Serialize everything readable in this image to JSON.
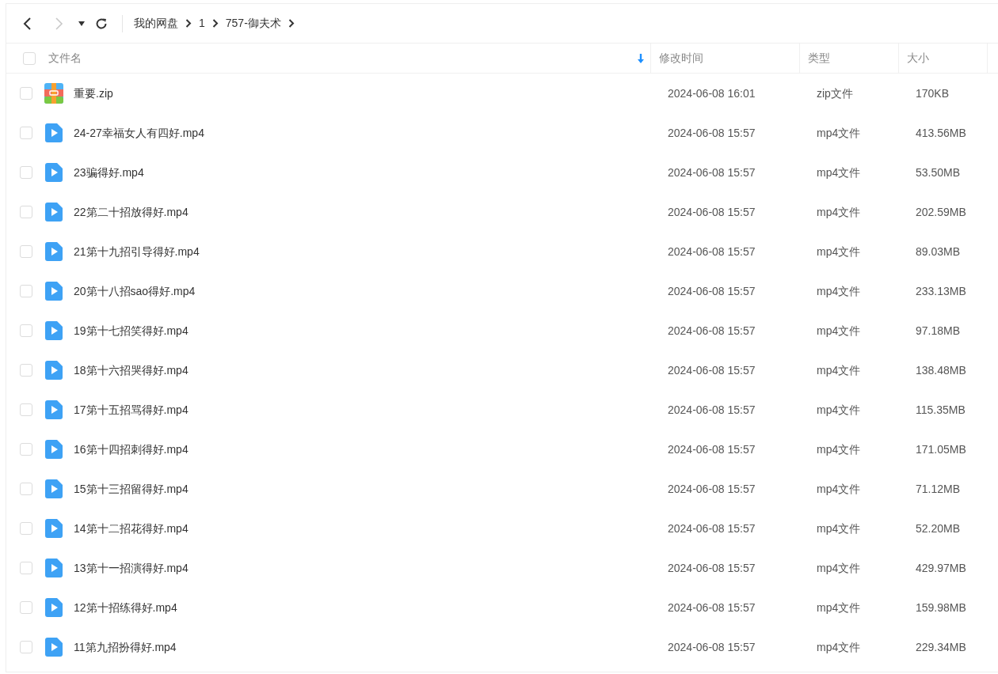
{
  "breadcrumb": [
    "我的网盘",
    "1",
    "757-御夫术"
  ],
  "select_all": {
    "checked": false
  },
  "columns": [
    {
      "label": "文件名"
    },
    {
      "label": "修改时间"
    },
    {
      "label": "类型"
    },
    {
      "label": "大小"
    }
  ],
  "rows": [
    {
      "kind": "zip",
      "name": "重要.zip",
      "modified": "2024-06-08 16:01",
      "type": "zip文件",
      "size": "170KB",
      "checked": false
    },
    {
      "kind": "video",
      "name": "24-27幸福女人有四好.mp4",
      "modified": "2024-06-08 15:57",
      "type": "mp4文件",
      "size": "413.56MB",
      "checked": false
    },
    {
      "kind": "video",
      "name": "23骗得好.mp4",
      "modified": "2024-06-08 15:57",
      "type": "mp4文件",
      "size": "53.50MB",
      "checked": false
    },
    {
      "kind": "video",
      "name": "22第二十招放得好.mp4",
      "modified": "2024-06-08 15:57",
      "type": "mp4文件",
      "size": "202.59MB",
      "checked": false
    },
    {
      "kind": "video",
      "name": "21第十九招引导得好.mp4",
      "modified": "2024-06-08 15:57",
      "type": "mp4文件",
      "size": "89.03MB",
      "checked": false
    },
    {
      "kind": "video",
      "name": "20第十八招sao得好.mp4",
      "modified": "2024-06-08 15:57",
      "type": "mp4文件",
      "size": "233.13MB",
      "checked": false
    },
    {
      "kind": "video",
      "name": "19第十七招笑得好.mp4",
      "modified": "2024-06-08 15:57",
      "type": "mp4文件",
      "size": "97.18MB",
      "checked": false
    },
    {
      "kind": "video",
      "name": "18第十六招哭得好.mp4",
      "modified": "2024-06-08 15:57",
      "type": "mp4文件",
      "size": "138.48MB",
      "checked": false
    },
    {
      "kind": "video",
      "name": "17第十五招骂得好.mp4",
      "modified": "2024-06-08 15:57",
      "type": "mp4文件",
      "size": "115.35MB",
      "checked": false
    },
    {
      "kind": "video",
      "name": "16第十四招刺得好.mp4",
      "modified": "2024-06-08 15:57",
      "type": "mp4文件",
      "size": "171.05MB",
      "checked": false
    },
    {
      "kind": "video",
      "name": "15第十三招留得好.mp4",
      "modified": "2024-06-08 15:57",
      "type": "mp4文件",
      "size": "71.12MB",
      "checked": false
    },
    {
      "kind": "video",
      "name": "14第十二招花得好.mp4",
      "modified": "2024-06-08 15:57",
      "type": "mp4文件",
      "size": "52.20MB",
      "checked": false
    },
    {
      "kind": "video",
      "name": "13第十一招演得好.mp4",
      "modified": "2024-06-08 15:57",
      "type": "mp4文件",
      "size": "429.97MB",
      "checked": false
    },
    {
      "kind": "video",
      "name": "12第十招练得好.mp4",
      "modified": "2024-06-08 15:57",
      "type": "mp4文件",
      "size": "159.98MB",
      "checked": false
    },
    {
      "kind": "video",
      "name": "11第九招扮得好.mp4",
      "modified": "2024-06-08 15:57",
      "type": "mp4文件",
      "size": "229.34MB",
      "checked": false
    }
  ]
}
